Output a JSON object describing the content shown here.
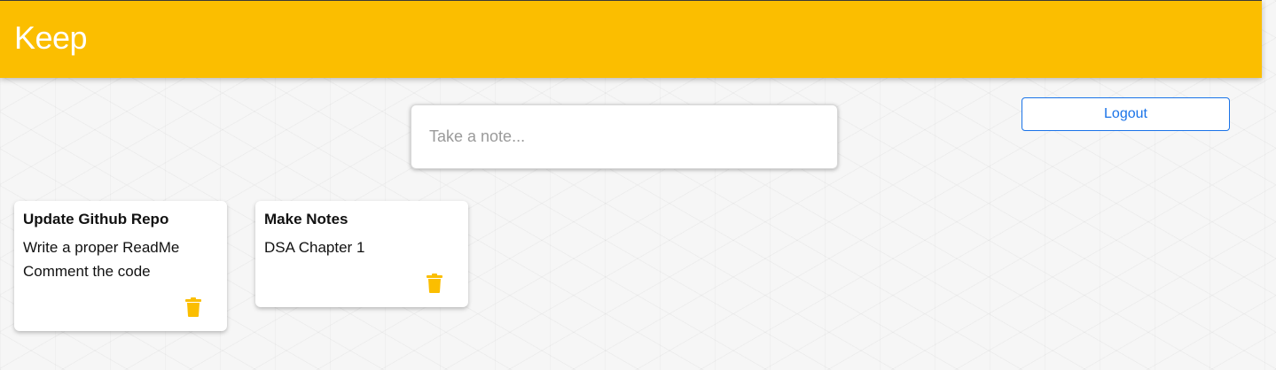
{
  "header": {
    "title": "Keep",
    "background_color": "#fbbe00"
  },
  "logout": {
    "label": "Logout",
    "color": "#1a73e8"
  },
  "create_note": {
    "placeholder": "Take a note...",
    "value": ""
  },
  "notes": [
    {
      "title": "Update Github Repo",
      "lines": [
        "Write a proper ReadMe",
        "Comment the code"
      ],
      "delete_icon": "trash-icon"
    },
    {
      "title": "Make Notes",
      "lines": [
        "DSA Chapter 1"
      ],
      "delete_icon": "trash-icon"
    }
  ],
  "accent_color": "#fbbe00"
}
